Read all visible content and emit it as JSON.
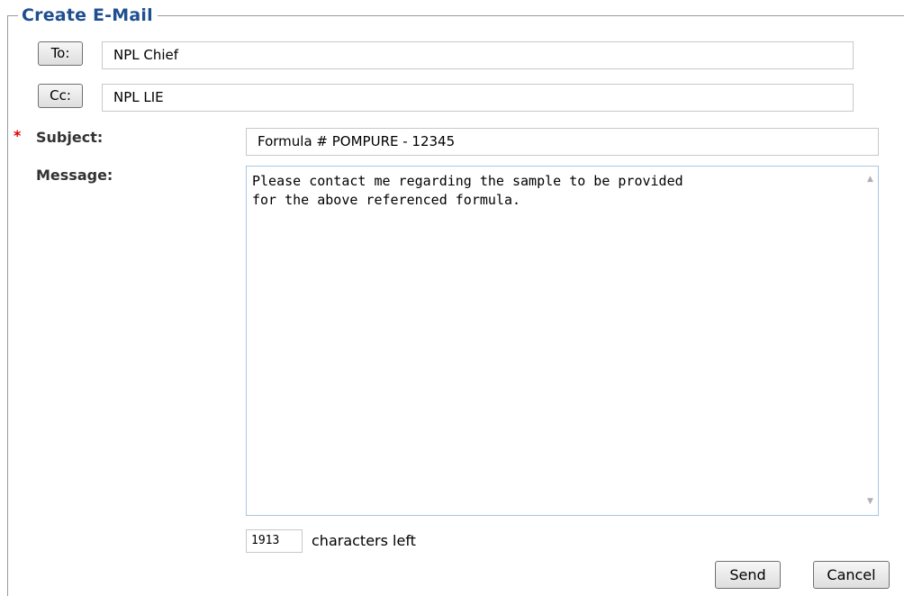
{
  "form": {
    "title": "Create E-Mail",
    "to_button_label": "To:",
    "to_value": "NPL Chief",
    "cc_button_label": "Cc:",
    "cc_value": "NPL LIE",
    "required_marker": "*",
    "subject_label": "Subject:",
    "subject_value": "Formula # POMPURE - 12345",
    "message_label": "Message:",
    "message_value": "Please contact me regarding the sample to be provided\nfor the above referenced formula.",
    "chars_left_value": "1913",
    "chars_left_label": "characters left",
    "send_label": "Send",
    "cancel_label": "Cancel"
  },
  "colors": {
    "title": "#1f4f8f",
    "required": "#e00000",
    "label": "#333333"
  },
  "icons": {
    "scroll_up": "scroll-up-arrow-icon",
    "scroll_down": "scroll-down-arrow-icon"
  }
}
